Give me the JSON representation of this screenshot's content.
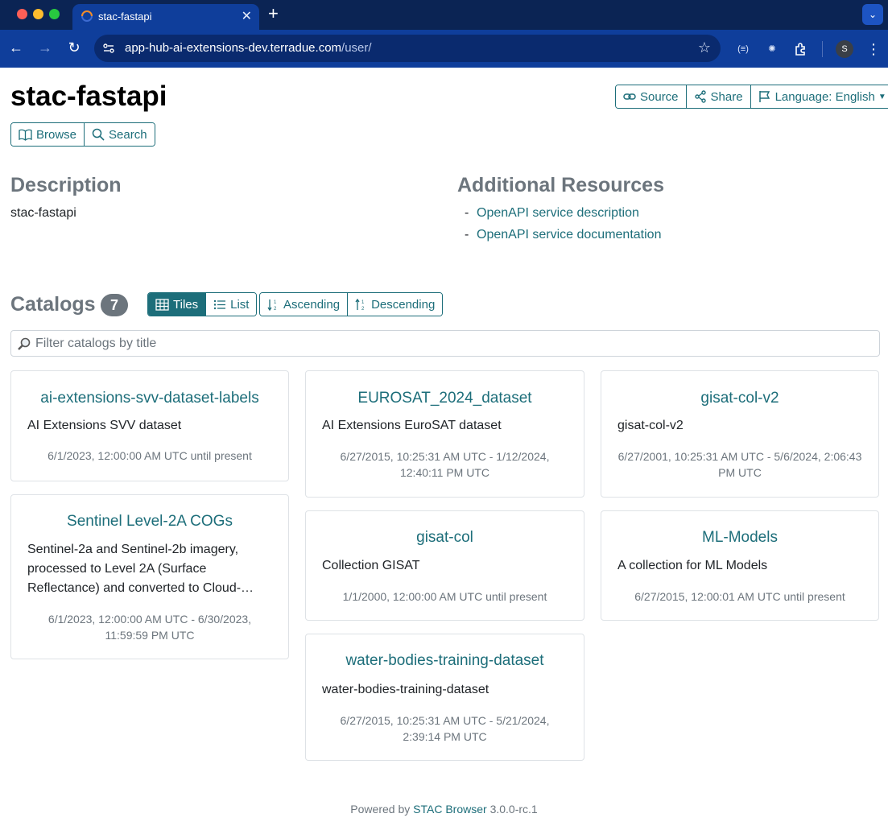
{
  "browser": {
    "tab_title": "stac-fastapi",
    "url_host": "app-hub-ai-extensions-dev.terradue.com",
    "url_path": "/user/",
    "avatar_letter": "S"
  },
  "header": {
    "title": "stac-fastapi",
    "source_label": "Source",
    "share_label": "Share",
    "language_label": "Language: English",
    "browse_label": "Browse",
    "search_label": "Search"
  },
  "description": {
    "heading": "Description",
    "text": "stac-fastapi"
  },
  "resources": {
    "heading": "Additional Resources",
    "items": [
      {
        "dash": "-",
        "label": "OpenAPI service description"
      },
      {
        "dash": "-",
        "label": "OpenAPI service documentation"
      }
    ]
  },
  "catalogs": {
    "heading": "Catalogs",
    "count": "7",
    "view_tiles": "Tiles",
    "view_list": "List",
    "sort_asc": "Ascending",
    "sort_desc": "Descending",
    "filter_placeholder": "Filter catalogs by title",
    "items": [
      {
        "title": "ai-extensions-svv-dataset-labels",
        "desc": "AI Extensions SVV dataset",
        "time": "6/1/2023, 12:00:00 AM UTC until present"
      },
      {
        "title": "EUROSAT_2024_dataset",
        "desc": "AI Extensions EuroSAT dataset",
        "time": "6/27/2015, 10:25:31 AM UTC - 1/12/2024, 12:40:11 PM UTC"
      },
      {
        "title": "gisat-col-v2",
        "desc": "gisat-col-v2",
        "time": "6/27/2001, 10:25:31 AM UTC - 5/6/2024, 2:06:43 PM UTC"
      },
      {
        "title": "Sentinel Level-2A COGs",
        "desc": "Sentinel-2a and Sentinel-2b imagery, processed to Level 2A (Surface Reflectance) and converted to Cloud-…",
        "time": "6/1/2023, 12:00:00 AM UTC - 6/30/2023, 11:59:59 PM UTC"
      },
      {
        "title": "gisat-col",
        "desc": "Collection GISAT",
        "time": "1/1/2000, 12:00:00 AM UTC until present"
      },
      {
        "title": "ML-Models",
        "desc": "A collection for ML Models",
        "time": "6/27/2015, 12:00:01 AM UTC until present"
      },
      {
        "title": "water-bodies-training-dataset",
        "desc": "water-bodies-training-dataset",
        "time": "6/27/2015, 10:25:31 AM UTC - 5/21/2024, 2:39:14 PM UTC"
      }
    ]
  },
  "footer": {
    "prefix": "Powered by",
    "link": "STAC Browser",
    "version": "3.0.0-rc.1"
  },
  "colors": {
    "accent": "#1d6e7a",
    "muted": "#6c757d",
    "chrome": "#0f3e9b"
  }
}
